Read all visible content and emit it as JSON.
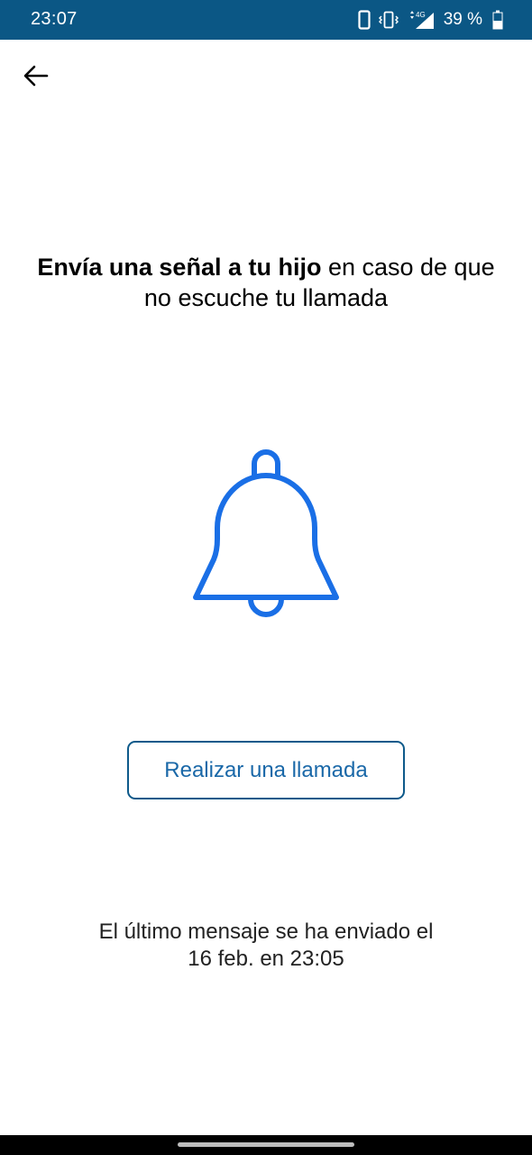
{
  "status_bar": {
    "time": "23:07",
    "network": "4G",
    "battery": "39 %"
  },
  "header": {
    "back_icon": "arrow-left-icon"
  },
  "main": {
    "headline_bold": "Envía una señal a tu hijo",
    "headline_rest": " en caso de que no escuche tu llamada",
    "bell_icon": "bell-icon",
    "call_button_label": "Realizar una llamada",
    "last_message_line1": "El último mensaje se ha enviado el",
    "last_message_line2": "16 feb. en 23:05"
  },
  "colors": {
    "status_bar": "#0b5785",
    "accent_blue": "#1a6fe6",
    "button_border": "#0e5a8a",
    "button_text": "#1a68a8"
  }
}
